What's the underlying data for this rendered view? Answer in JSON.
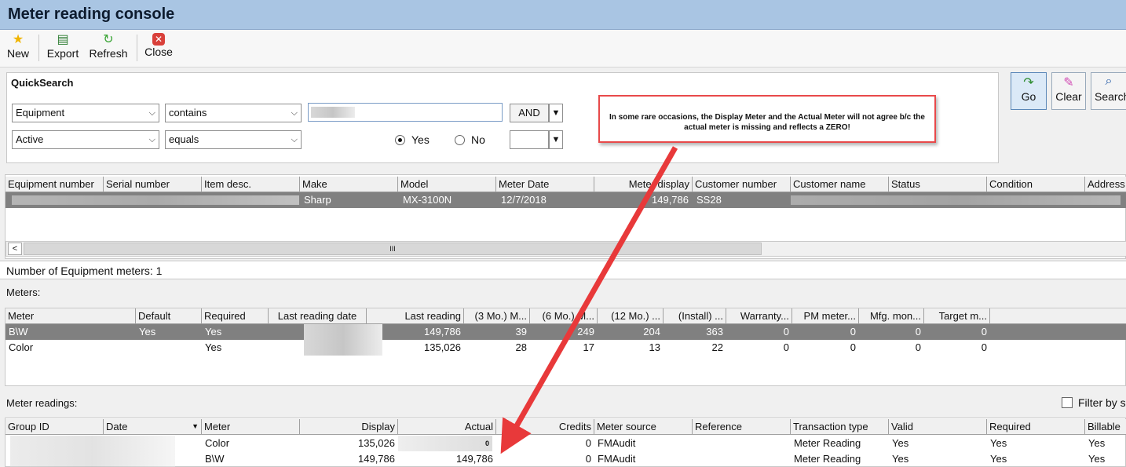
{
  "title": "Meter reading console",
  "toolbar": {
    "new": "New",
    "export": "Export",
    "refresh": "Refresh",
    "close": "Close"
  },
  "quicksearch": {
    "label": "QuickSearch",
    "field1": "Equipment",
    "op1": "contains",
    "join": "AND",
    "field2": "Active",
    "op2": "equals",
    "yes": "Yes",
    "no": "No",
    "selected": "Yes"
  },
  "actions": {
    "go": "Go",
    "clear": "Clear",
    "search": "Search"
  },
  "callout": "In some rare occasions, the Display Meter and the Actual Meter will not agree b/c the actual meter is missing and reflects a ZERO!",
  "equipment": {
    "headers": [
      "Equipment number",
      "Serial number",
      "Item desc.",
      "Make",
      "Model",
      "Meter Date",
      "Meter display",
      "Customer number",
      "Customer name",
      "Status",
      "Condition",
      "Address"
    ],
    "row": {
      "make": "Sharp",
      "model": "MX-3100N",
      "meter_date": "12/7/2018",
      "meter_display": "149,786",
      "customer_number": "SS28"
    },
    "scroll_mark": "III",
    "count": "Number of Equipment meters: 1"
  },
  "meters": {
    "label": "Meters:",
    "headers": [
      "Meter",
      "Default",
      "Required",
      "Last reading date",
      "Last reading",
      "(3 Mo.) M...",
      "(6 Mo.) M...",
      "(12 Mo.) ...",
      "(Install) ...",
      "Warranty...",
      "PM meter...",
      "Mfg. mon...",
      "Target m..."
    ],
    "rows": [
      {
        "meter": "B\\W",
        "default": "Yes",
        "required": "Yes",
        "last_reading": "149,786",
        "m3": "39",
        "m6": "249",
        "m12": "204",
        "install": "363",
        "warranty": "0",
        "pm": "0",
        "mfg": "0",
        "target": "0"
      },
      {
        "meter": "Color",
        "default": "",
        "required": "Yes",
        "last_reading": "135,026",
        "m3": "28",
        "m6": "17",
        "m12": "13",
        "install": "22",
        "warranty": "0",
        "pm": "0",
        "mfg": "0",
        "target": "0"
      }
    ]
  },
  "readings": {
    "label": "Meter readings:",
    "filter": "Filter by s",
    "headers": [
      "Group ID",
      "Date",
      "Meter",
      "Display",
      "Actual",
      "Credits",
      "Meter source",
      "Reference",
      "Transaction type",
      "Valid",
      "Required",
      "Billable"
    ],
    "rows": [
      {
        "meter": "Color",
        "display": "135,026",
        "actual": "0",
        "credits": "0",
        "source": "FMAudit",
        "reference": "",
        "type": "Meter Reading",
        "valid": "Yes",
        "required": "Yes",
        "billable": "Yes"
      },
      {
        "meter": "B\\W",
        "display": "149,786",
        "actual": "149,786",
        "credits": "0",
        "source": "FMAudit",
        "reference": "",
        "type": "Meter Reading",
        "valid": "Yes",
        "required": "Yes",
        "billable": "Yes"
      }
    ]
  },
  "colors": {
    "title_bg": "#a9c5e3",
    "selected_row": "#808080",
    "callout_border": "#e8494a",
    "arrow": "#e8393a"
  }
}
